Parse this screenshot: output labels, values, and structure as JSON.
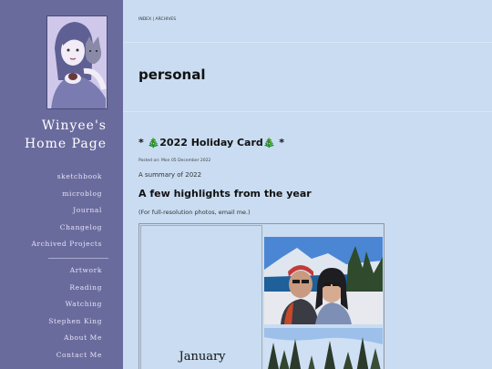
{
  "sidebar": {
    "title_line1": "Winyee's",
    "title_line2": "Home Page",
    "nav_primary": [
      "sketchbook",
      "microblog",
      "Journal",
      "Changelog",
      "Archived Projects"
    ],
    "nav_secondary": [
      "Artwork",
      "Reading",
      "Watching",
      "Stephen King",
      "About Me",
      "Contact Me"
    ]
  },
  "breadcrumb": {
    "index": "INDEX",
    "separator": " | ",
    "archives": "ARCHIVES"
  },
  "page_title": "personal",
  "post": {
    "title": "* 🎄2022 Holiday Card🎄 *",
    "date": "Posted on: Mon 05 December 2022",
    "summary": "A summary of 2022",
    "heading": "A few highlights from the year",
    "note": "(For full-resolution photos, email me.)",
    "month": "January"
  },
  "colors": {
    "sidebar": "#6a6b9d",
    "background": "#c9dcf1"
  }
}
